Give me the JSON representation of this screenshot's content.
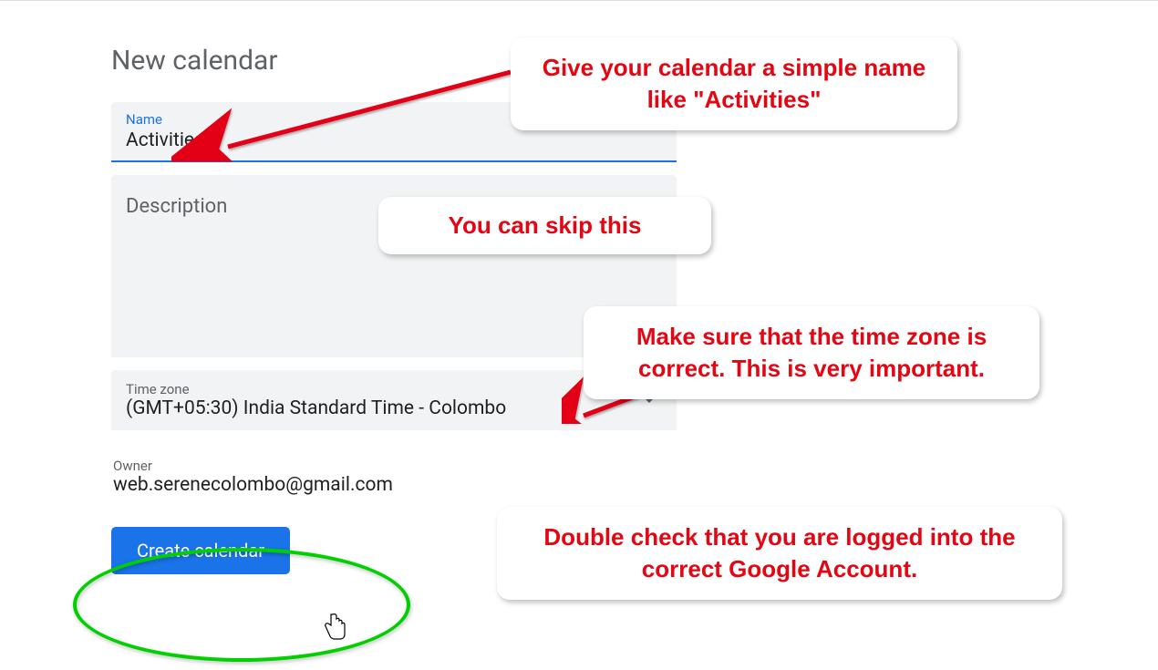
{
  "page": {
    "title": "New calendar"
  },
  "fields": {
    "name": {
      "label": "Name",
      "value": "Activities"
    },
    "description": {
      "label": "Description"
    },
    "timezone": {
      "label": "Time zone",
      "value": "(GMT+05:30) India Standard Time - Colombo"
    },
    "owner": {
      "label": "Owner",
      "value": "web.serenecolombo@gmail.com"
    }
  },
  "actions": {
    "create": "Create calendar"
  },
  "annotations": {
    "name_tip": "Give your calendar a simple name like \"Activities\"",
    "description_tip": "You can skip this",
    "timezone_tip": "Make sure that the time zone is correct. This is very important.",
    "owner_tip": "Double check that you are logged into the correct Google Account."
  },
  "colors": {
    "annotation_red": "#e30613",
    "accent_blue": "#1a73e8",
    "highlight_green": "#00d000"
  }
}
